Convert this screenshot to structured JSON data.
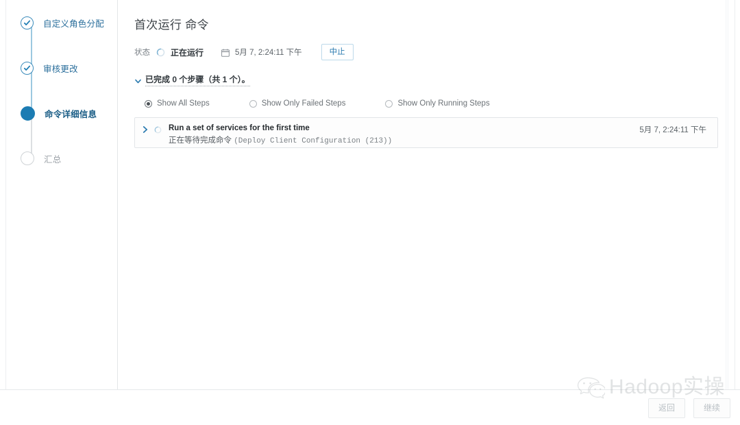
{
  "wizard": {
    "steps": [
      {
        "label": "自定义角色分配",
        "state": "done",
        "icon": "check-circle-icon"
      },
      {
        "label": "审核更改",
        "state": "done",
        "icon": "check-circle-icon"
      },
      {
        "label": "命令详细信息",
        "state": "active",
        "icon": "filled-circle-icon"
      },
      {
        "label": "汇总",
        "state": "pending",
        "icon": "empty-circle-icon"
      }
    ]
  },
  "main": {
    "title": "首次运行 命令",
    "status": {
      "label": "状态",
      "spinner_icon": "spinner-icon",
      "value": "正在运行",
      "calendar_icon": "calendar-icon",
      "date": "5月 7, 2:24:11 下午",
      "abort_button": "中止"
    },
    "progress": {
      "chevron_icon": "chevron-down-icon",
      "text": "已完成 0 个步骤（共 1 个）。"
    },
    "filters": [
      {
        "label": "Show All Steps",
        "checked": true
      },
      {
        "label": "Show Only Failed Steps",
        "checked": false
      },
      {
        "label": "Show Only Running Steps",
        "checked": false
      }
    ],
    "step_card": {
      "expand_icon": "chevron-right-icon",
      "spinner_icon": "spinner-icon",
      "title": "Run a set of services for the first time",
      "subtitle_prefix": "正在等待完成命令",
      "subtitle_mono": "(Deploy Client Configuration (213))",
      "time": "5月 7, 2:24:11 下午"
    }
  },
  "footer": {
    "back_button": "返回",
    "continue_button": "继续"
  },
  "watermark": {
    "logo_icon": "wechat-icon",
    "text": "Hadoop实操"
  },
  "colors": {
    "accent": "#1c7cb3",
    "step_link": "#2b6f9c",
    "track": "#9cc8e0",
    "track_pending": "#dcdfe2",
    "border": "#e2e5e8",
    "text_primary": "#32383d",
    "text_muted": "#7a8187"
  }
}
